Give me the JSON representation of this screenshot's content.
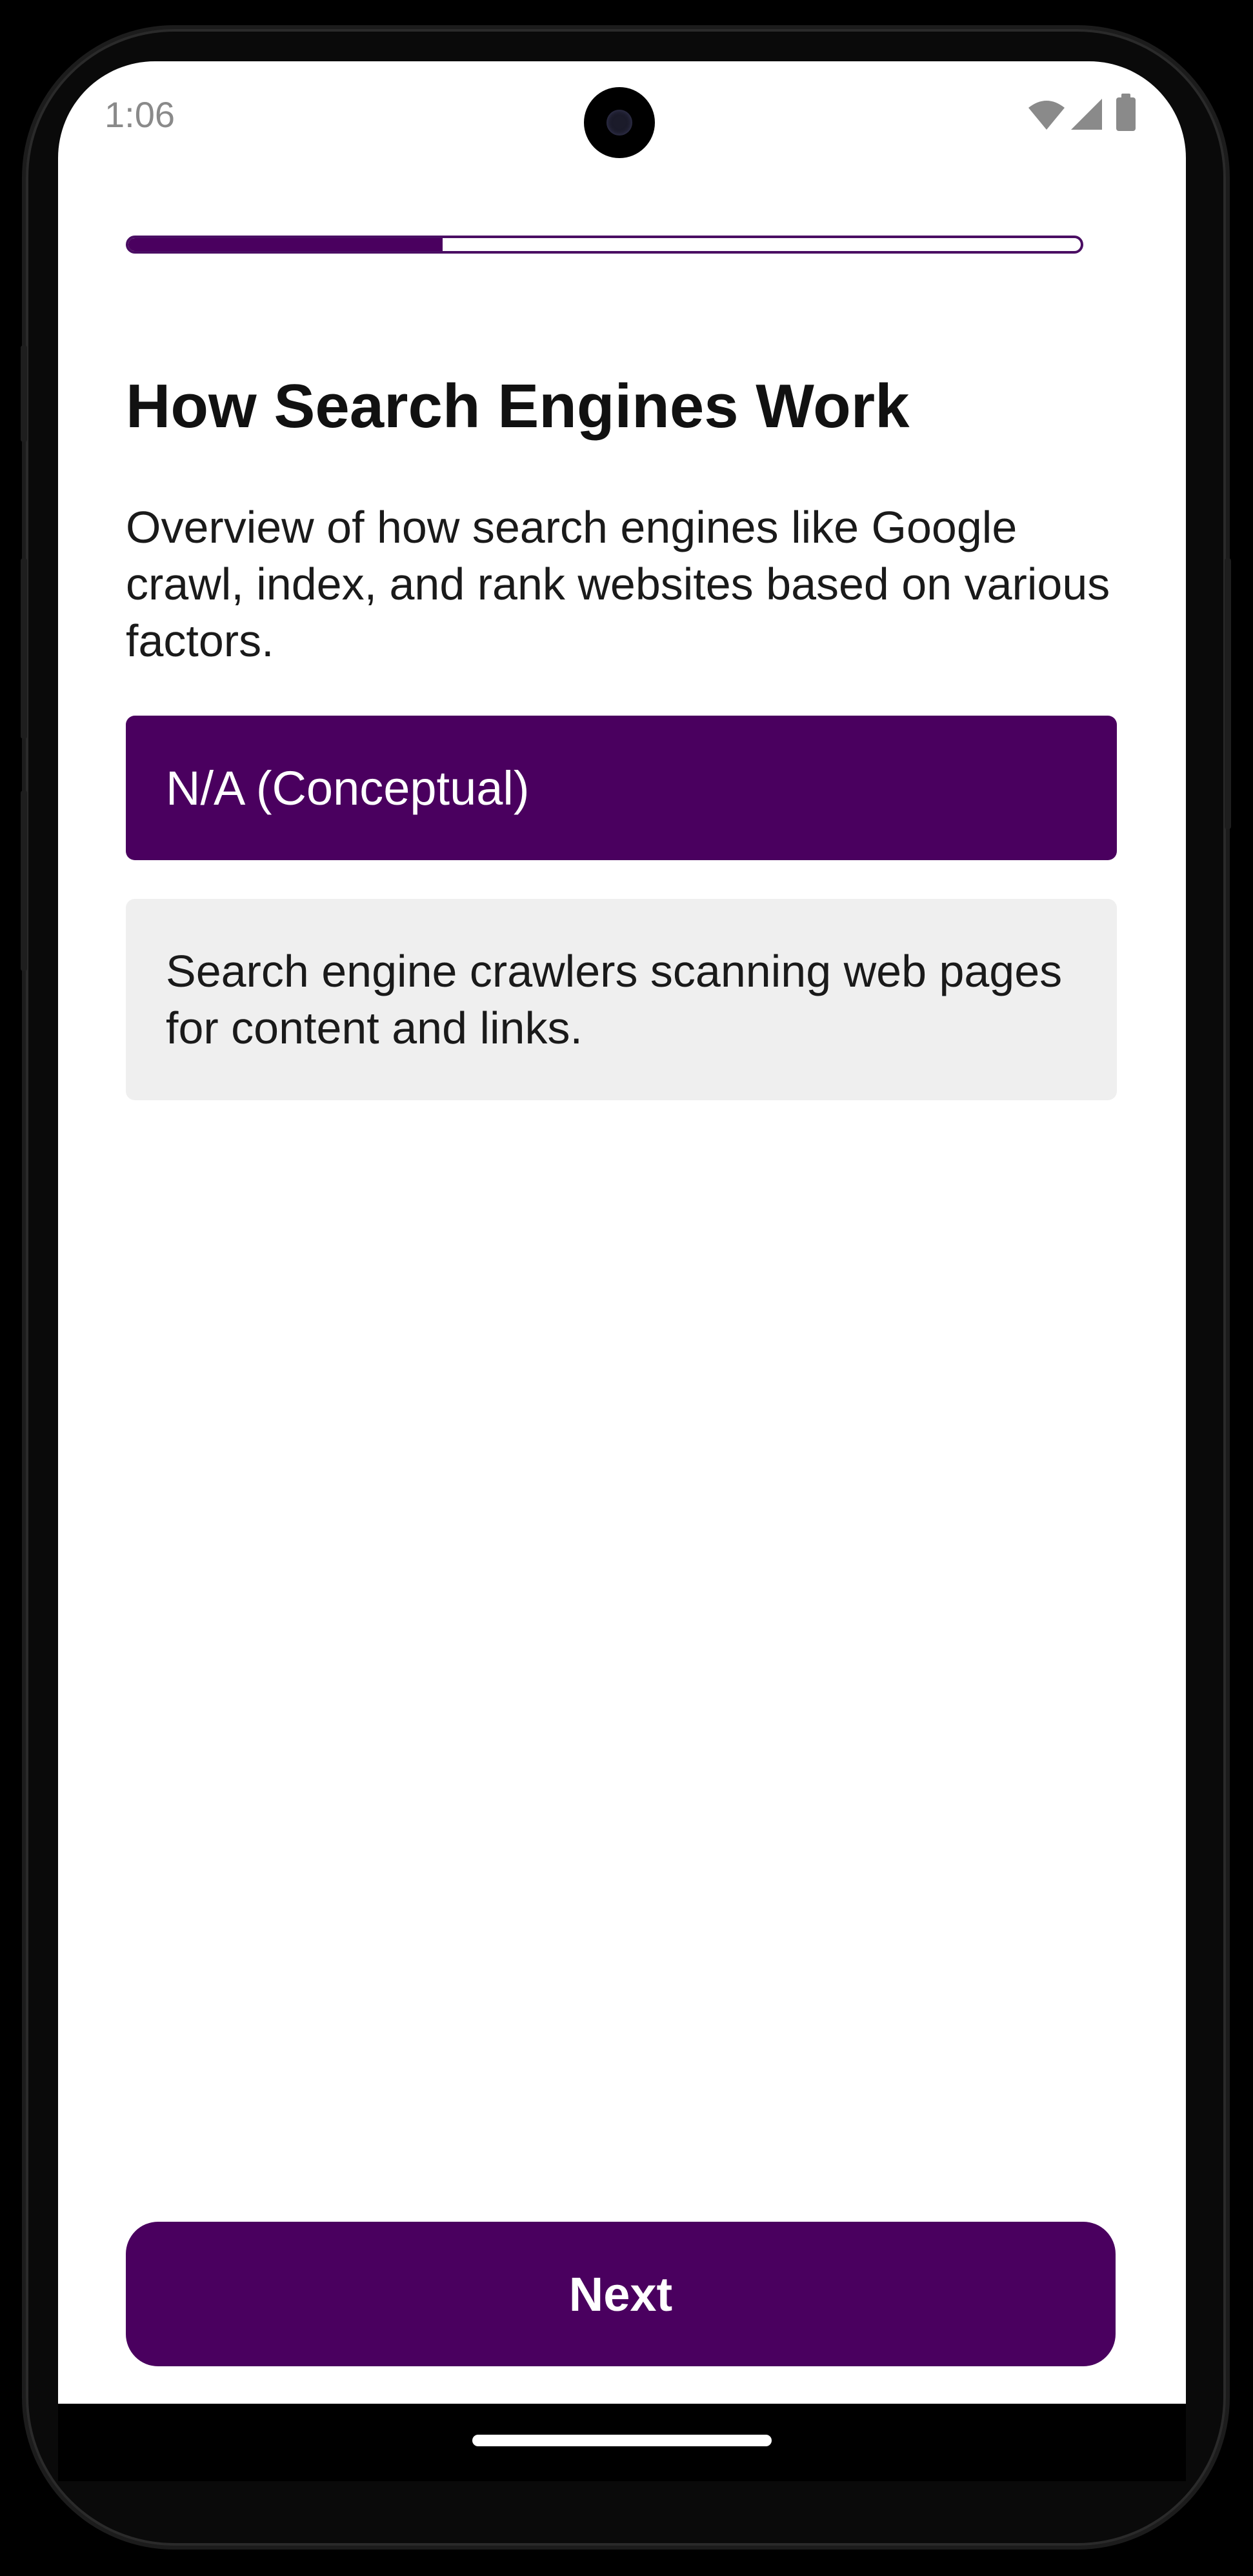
{
  "status_bar": {
    "time": "1:06",
    "icons": [
      "wifi-icon",
      "cellular-signal-icon",
      "battery-icon"
    ]
  },
  "progress": {
    "value_fraction": 0.33
  },
  "lesson": {
    "title": "How Search Engines Work",
    "description": "Overview of how search engines like Google crawl, index, and rank websites based on various factors.",
    "answer_label": "N/A (Conceptual)",
    "info_text": "Search engine crawlers scanning web pages for content and links."
  },
  "actions": {
    "next_label": "Next"
  },
  "colors": {
    "primary": "#4a005f",
    "info_background": "#efefef",
    "text": "#1a1a1a"
  }
}
